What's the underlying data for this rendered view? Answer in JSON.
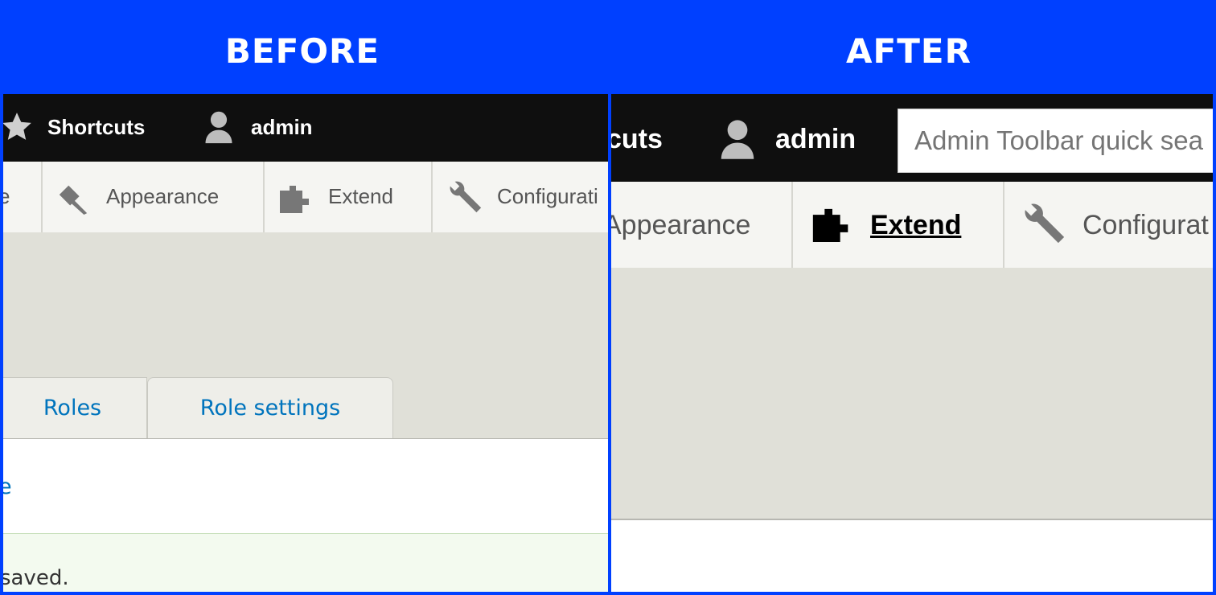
{
  "before": {
    "heading": "BEFORE",
    "toolbar": {
      "shortcuts_label": "Shortcuts",
      "user_label": "admin"
    },
    "tray": {
      "items": [
        {
          "label": "e"
        },
        {
          "label": "Appearance",
          "icon": "paintbrush-icon"
        },
        {
          "label": "Extend",
          "icon": "puzzle-icon"
        },
        {
          "label": "Configurati",
          "icon": "wrench-icon"
        }
      ]
    },
    "tabs": [
      "Roles",
      "Role settings"
    ],
    "content": {
      "link_fragment": "e",
      "message_fragment": "saved."
    }
  },
  "after": {
    "heading": "AFTER",
    "toolbar": {
      "shortcuts_fragment": "cuts",
      "user_label": "admin",
      "search_placeholder": "Admin Toolbar quick sea"
    },
    "tray": {
      "items": [
        {
          "label": "Appearance"
        },
        {
          "label": "Extend",
          "icon": "puzzle-icon",
          "active": true
        },
        {
          "label": "Configurat",
          "icon": "wrench-icon"
        }
      ]
    }
  },
  "colors": {
    "background": "#0040ff",
    "toolbar": "#0f0f0f",
    "tray": "#f5f5f2",
    "link": "#0074bd",
    "message_bg": "#f3faef"
  }
}
